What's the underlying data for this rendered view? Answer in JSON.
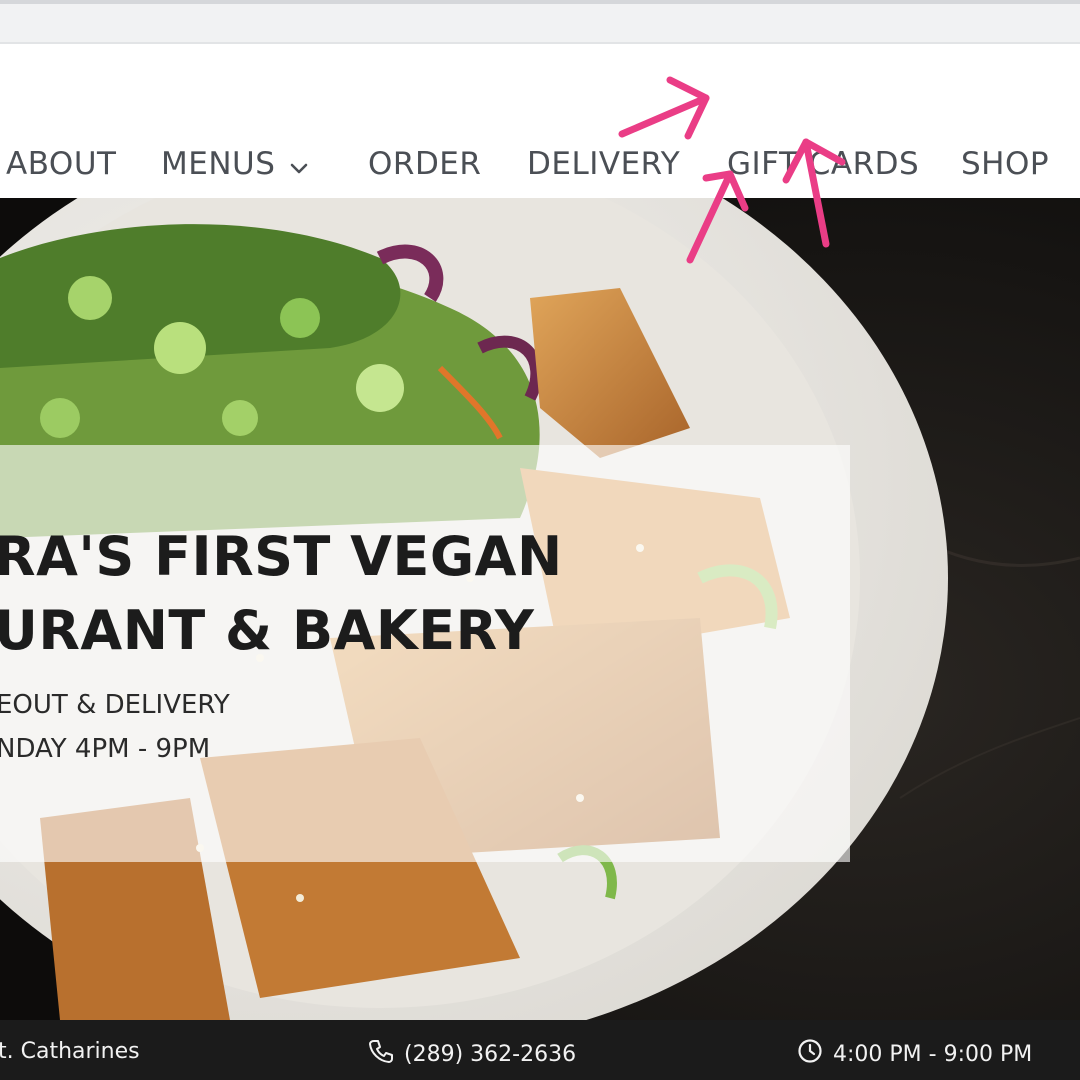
{
  "nav": {
    "items": [
      {
        "label": "ABOUT"
      },
      {
        "label": "MENUS"
      },
      {
        "label": "ORDER"
      },
      {
        "label": "DELIVERY"
      },
      {
        "label": "GIFT CARDS"
      },
      {
        "label": "SHOP"
      }
    ]
  },
  "hero": {
    "title_line1": "RA'S FIRST VEGAN",
    "title_line2": "URANT & BAKERY",
    "sub_line1": "EOUT & DELIVERY",
    "sub_line2": "NDAY 4PM - 9PM"
  },
  "info_bar": {
    "location": "t. Catharines",
    "phone": "(289) 362-2636",
    "hours": "4:00 PM - 9:00 PM"
  },
  "icons": {
    "menus_dropdown": "chevron-down-icon",
    "phone": "phone-icon",
    "hours": "clock-icon",
    "annotation": "arrow-icon"
  },
  "colors": {
    "nav_text": "#4b4f55",
    "annotation_pink": "#ea3d86",
    "info_bar_bg": "#1b1b1b",
    "hero_bg": "#141414"
  }
}
